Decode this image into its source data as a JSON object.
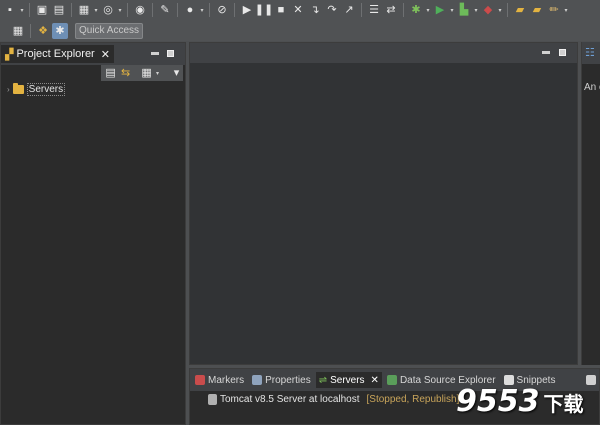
{
  "toolbar": {
    "row1_icons": [
      "new-icon",
      "save-icon",
      "save-all-icon",
      "new-server-icon",
      "web-icon",
      "globe-icon",
      "search-icon",
      "person-icon",
      "skip-icon",
      "resume-icon",
      "suspend-icon",
      "stop-icon",
      "disconnect-icon",
      "step-into-icon",
      "step-over-icon",
      "step-return-icon",
      "use-step-filters-icon",
      "run-last-icon",
      "debug-icon",
      "run-icon",
      "external-tools-icon",
      "coverage-icon",
      "open-type-icon",
      "open-task-icon",
      "edit-icon"
    ],
    "row2_icons": [
      "open-perspective-icon",
      "java-ee-perspective-icon",
      "debug-perspective-icon"
    ],
    "quick_access_placeholder": "Quick Access"
  },
  "project_explorer": {
    "title": "Project Explorer",
    "toolbar_icons": [
      "collapse-all-icon",
      "link-with-editor-icon",
      "focus-icon",
      "view-menu-icon"
    ],
    "tree": [
      {
        "label": "Servers",
        "icon": "folder-icon"
      }
    ]
  },
  "right_panel": {
    "text": "An o"
  },
  "bottom_tabs": [
    {
      "label": "Markers",
      "icon": "markers-icon",
      "active": false
    },
    {
      "label": "Properties",
      "icon": "properties-icon",
      "active": false
    },
    {
      "label": "Servers",
      "icon": "servers-icon",
      "active": true
    },
    {
      "label": "Data Source Explorer",
      "icon": "data-source-icon",
      "active": false
    },
    {
      "label": "Snippets",
      "icon": "snippets-icon",
      "active": false
    }
  ],
  "servers": {
    "row_label": "Tomcat v8.5 Server at localhost",
    "row_status": "[Stopped, Republish]"
  },
  "watermark": {
    "text": "9553",
    "subtext": "下载"
  },
  "colors": {
    "background": "#4d4f51",
    "panel": "#2b2b2b",
    "editor": "#313335",
    "status_text": "#c8a45a",
    "watermark": "#ffffff"
  }
}
